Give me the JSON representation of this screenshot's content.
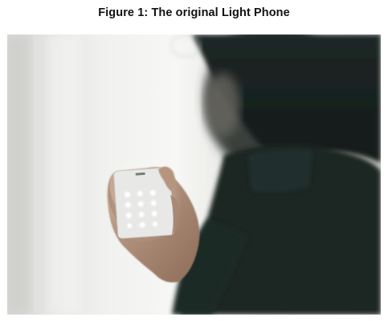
{
  "figure": {
    "caption": "Figure 1: The original Light Phone"
  },
  "photo": {
    "subject": "phone",
    "colors": {
      "wall_light": "#f1f1ef",
      "wall_shadow": "#c9cac7",
      "figure_dark": "#1c2a28",
      "skin": "#b89a86",
      "phone_body": "#eaebe9",
      "phone_glow": "#ffffff"
    }
  }
}
